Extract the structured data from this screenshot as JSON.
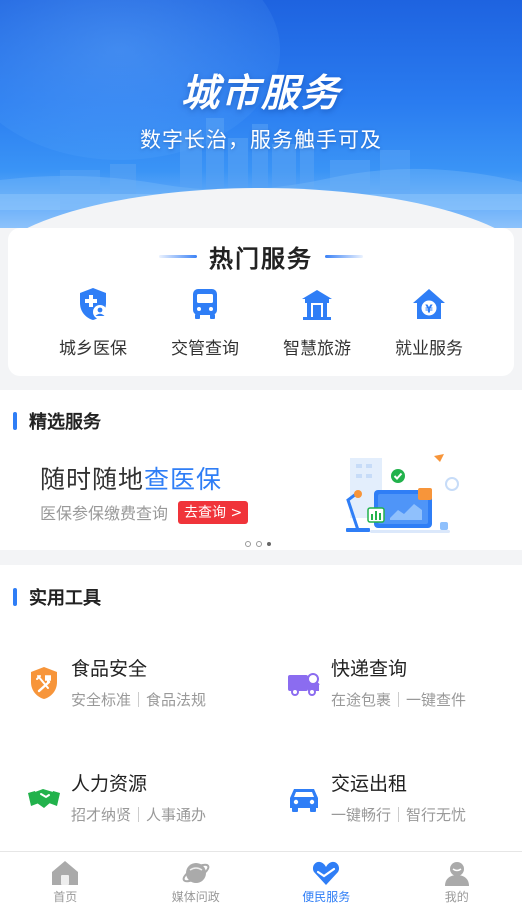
{
  "banner": {
    "title": "城市服务",
    "subtitle": "数字长治，服务触手可及"
  },
  "hot_services": {
    "title": "热门服务",
    "items": [
      {
        "label": "城乡医保",
        "icon": "medical-insurance-shield-icon"
      },
      {
        "label": "交管查询",
        "icon": "bus-icon"
      },
      {
        "label": "智慧旅游",
        "icon": "pavilion-icon"
      },
      {
        "label": "就业服务",
        "icon": "yuan-house-icon"
      }
    ]
  },
  "featured": {
    "section_title": "精选服务",
    "headline_prefix": "随时随地",
    "headline_highlight": "查医保",
    "subtitle": "医保参保缴费查询",
    "button_label": "去查询 >",
    "carousel_count": 3,
    "carousel_active": 2
  },
  "tools": {
    "section_title": "实用工具",
    "items": [
      {
        "name": "食品安全",
        "desc_a": "安全标准",
        "desc_b": "食品法规",
        "icon": "food-safety-shield-icon",
        "color": "#f7953a"
      },
      {
        "name": "快递查询",
        "desc_a": "在途包裹",
        "desc_b": "一键查件",
        "icon": "delivery-truck-icon",
        "color": "#8b6cf0"
      },
      {
        "name": "人力资源",
        "desc_a": "招才纳贤",
        "desc_b": "人事通办",
        "icon": "handshake-icon",
        "color": "#22b24c"
      },
      {
        "name": "交运出租",
        "desc_a": "一键畅行",
        "desc_b": "智行无忧",
        "icon": "taxi-car-icon",
        "color": "#2f7ef6"
      }
    ]
  },
  "tabbar": {
    "items": [
      {
        "label": "首页",
        "icon": "home-icon",
        "active": false
      },
      {
        "label": "媒体问政",
        "icon": "planet-icon",
        "active": false
      },
      {
        "label": "便民服务",
        "icon": "heart-hands-icon",
        "active": true
      },
      {
        "label": "我的",
        "icon": "user-icon",
        "active": false
      }
    ]
  },
  "colors": {
    "accent": "#2f7ef6",
    "red_button": "#f0343a",
    "banner_blue": "#2a7cf0"
  }
}
